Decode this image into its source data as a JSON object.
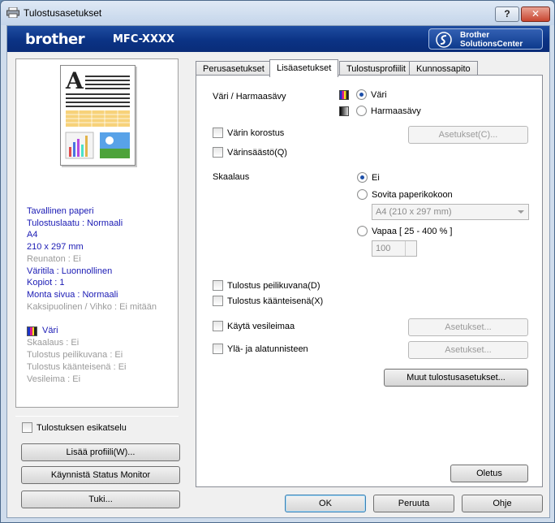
{
  "window": {
    "title": "Tulostusasetukset",
    "help": "?",
    "close": "✕"
  },
  "banner": {
    "brand": "brother",
    "model": "MFC-XXXX",
    "solutions_line1": "Brother",
    "solutions_line2": "SolutionsCenter"
  },
  "left": {
    "info": [
      {
        "text": "Tavallinen paperi",
        "style": "blue"
      },
      {
        "text": "Tulostuslaatu : Normaali",
        "style": "blue"
      },
      {
        "text": "A4",
        "style": "blue"
      },
      {
        "text": "210 x 297 mm",
        "style": "blue"
      },
      {
        "text": "Reunaton : Ei",
        "style": "grey"
      },
      {
        "text": "Väritila : Luonnollinen",
        "style": "blue"
      },
      {
        "text": "Kopiot : 1",
        "style": "blue"
      },
      {
        "text": "Monta sivua : Normaali",
        "style": "blue"
      },
      {
        "text": "Kaksipuolinen / Vihko : Ei mitään",
        "style": "grey"
      }
    ],
    "color_mode": "Väri",
    "color_info": [
      "Skaalaus : Ei",
      "Tulostus peilikuvana : Ei",
      "Tulostus käänteisenä : Ei",
      "Vesileima : Ei"
    ],
    "preview_checkbox": "Tulostuksen esikatselu",
    "add_profile": "Lisää profiili(W)...",
    "status_monitor": "Käynnistä Status Monitor",
    "support": "Tuki..."
  },
  "tabs": [
    "Perusasetukset",
    "Lisäasetukset",
    "Tulostusprofiilit",
    "Kunnossapito"
  ],
  "advanced": {
    "color_label": "Väri / Harmaasävy",
    "color_option": "Väri",
    "gray_option": "Harmaasävy",
    "enhance": "Värin korostus",
    "settings_c": "Asetukset(C)...",
    "ink_save": "Värinsäästö(Q)",
    "scaling_label": "Skaalaus",
    "scale_off": "Ei",
    "fit_paper": "Sovita paperikokoon",
    "paper_size": "A4 (210 x 297 mm)",
    "free": "Vapaa [ 25 - 400 % ]",
    "free_value": "100",
    "mirror": "Tulostus peilikuvana(D)",
    "reverse": "Tulostus käänteisenä(X)",
    "watermark": "Käytä vesileimaa",
    "watermark_settings": "Asetukset...",
    "header_footer": "Ylä- ja alatunnisteen",
    "header_settings": "Asetukset...",
    "other": "Muut tulostusasetukset...",
    "default": "Oletus"
  },
  "dialog": {
    "ok": "OK",
    "cancel": "Peruuta",
    "help": "Ohje"
  },
  "colors": {
    "banner": "#0b3385",
    "title": "#c4d5ea",
    "close": "#c8452f"
  }
}
